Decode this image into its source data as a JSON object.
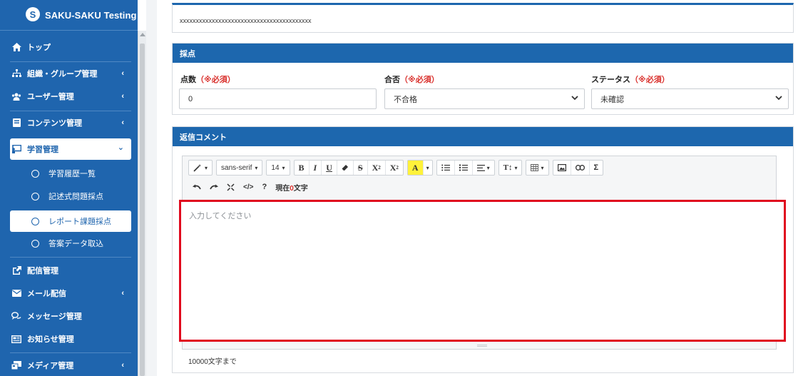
{
  "brand": {
    "logo_letter": "S",
    "title": "SAKU-SAKU Testing"
  },
  "sidebar": {
    "items": [
      {
        "label": "トップ",
        "icon": "home-icon",
        "arrow": ""
      },
      {
        "label": "組織・グループ管理",
        "icon": "sitemap-icon",
        "arrow": "‹"
      },
      {
        "label": "ユーザー管理",
        "icon": "users-icon",
        "arrow": "‹"
      },
      {
        "label": "コンテンツ管理",
        "icon": "book-icon",
        "arrow": "‹"
      },
      {
        "label": "学習管理",
        "icon": "chalkboard-icon",
        "arrow": "⌄"
      }
    ],
    "sub_items": [
      {
        "label": "学習履歴一覧"
      },
      {
        "label": "記述式問題採点"
      },
      {
        "label": "レポート課題採点"
      },
      {
        "label": "答案データ取込"
      }
    ],
    "items_after": [
      {
        "label": "配信管理",
        "icon": "share-icon",
        "arrow": ""
      },
      {
        "label": "メール配信",
        "icon": "envelope-icon",
        "arrow": "‹"
      },
      {
        "label": "メッセージ管理",
        "icon": "comments-icon",
        "arrow": ""
      },
      {
        "label": "お知らせ管理",
        "icon": "newspaper-icon",
        "arrow": ""
      },
      {
        "label": "メディア管理",
        "icon": "photo-video-icon",
        "arrow": "‹"
      }
    ]
  },
  "top_panel": {
    "text": "xxxxxxxxxxxxxxxxxxxxxxxxxxxxxxxxxxxxxxxxx"
  },
  "score_panel": {
    "title": "採点",
    "score_label": "点数",
    "score_required": "（※必須）",
    "score_value": "0",
    "pass_label": "合否",
    "pass_required": "（※必須）",
    "pass_value": "不合格",
    "status_label": "ステータス",
    "status_required": "（※必須）",
    "status_value": "未確認"
  },
  "comment_panel": {
    "title": "返信コメント",
    "placeholder": "入力してください",
    "limit_note": "10000文字まで",
    "toolbar": {
      "font_family": "sans-serif",
      "font_size": "14",
      "char_count_prefix": "現在",
      "char_count_value": "0",
      "char_count_suffix": "文字"
    }
  },
  "colors": {
    "primary": "#1f65ae",
    "required": "#d9302c",
    "highlight_border": "#e0091e"
  }
}
